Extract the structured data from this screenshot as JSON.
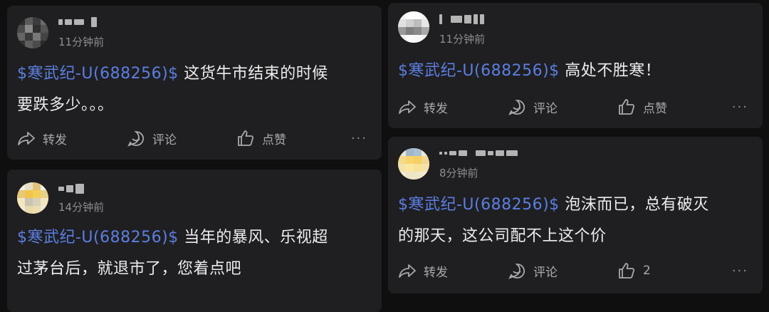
{
  "posts": [
    {
      "time": "11分钟前",
      "tag": "$寒武纪-U(688256)$",
      "text_line1": "这货牛市结束的时候",
      "text_line2": "要跌多少。。。",
      "share_label": "转发",
      "comment_label": "评论",
      "like_label": "点赞"
    },
    {
      "time": "14分钟前",
      "tag": "$寒武纪-U(688256)$",
      "text_line1": "当年的暴风、乐视超",
      "text_line2": "过茅台后，就退市了，您着点吧"
    },
    {
      "time": "11分钟前",
      "tag": "$寒武纪-U(688256)$",
      "text_line1": "高处不胜寒！",
      "share_label": "转发",
      "comment_label": "评论",
      "like_label": "点赞"
    },
    {
      "time": "8分钟前",
      "tag": "$寒武纪-U(688256)$",
      "text_line1": "泡沫而已，总有破灭",
      "text_line2": "的那天，这公司配不上这个价",
      "share_label": "转发",
      "comment_label": "评论",
      "like_label": "2"
    }
  ],
  "more_glyph": "···",
  "colors": {
    "background": "#0f0f10",
    "card": "#1f1f21",
    "accent": "#5b7fe0",
    "muted": "#8d8d91"
  },
  "icons": [
    "share-icon",
    "comment-icon",
    "thumbs-up-icon",
    "more-icon"
  ]
}
